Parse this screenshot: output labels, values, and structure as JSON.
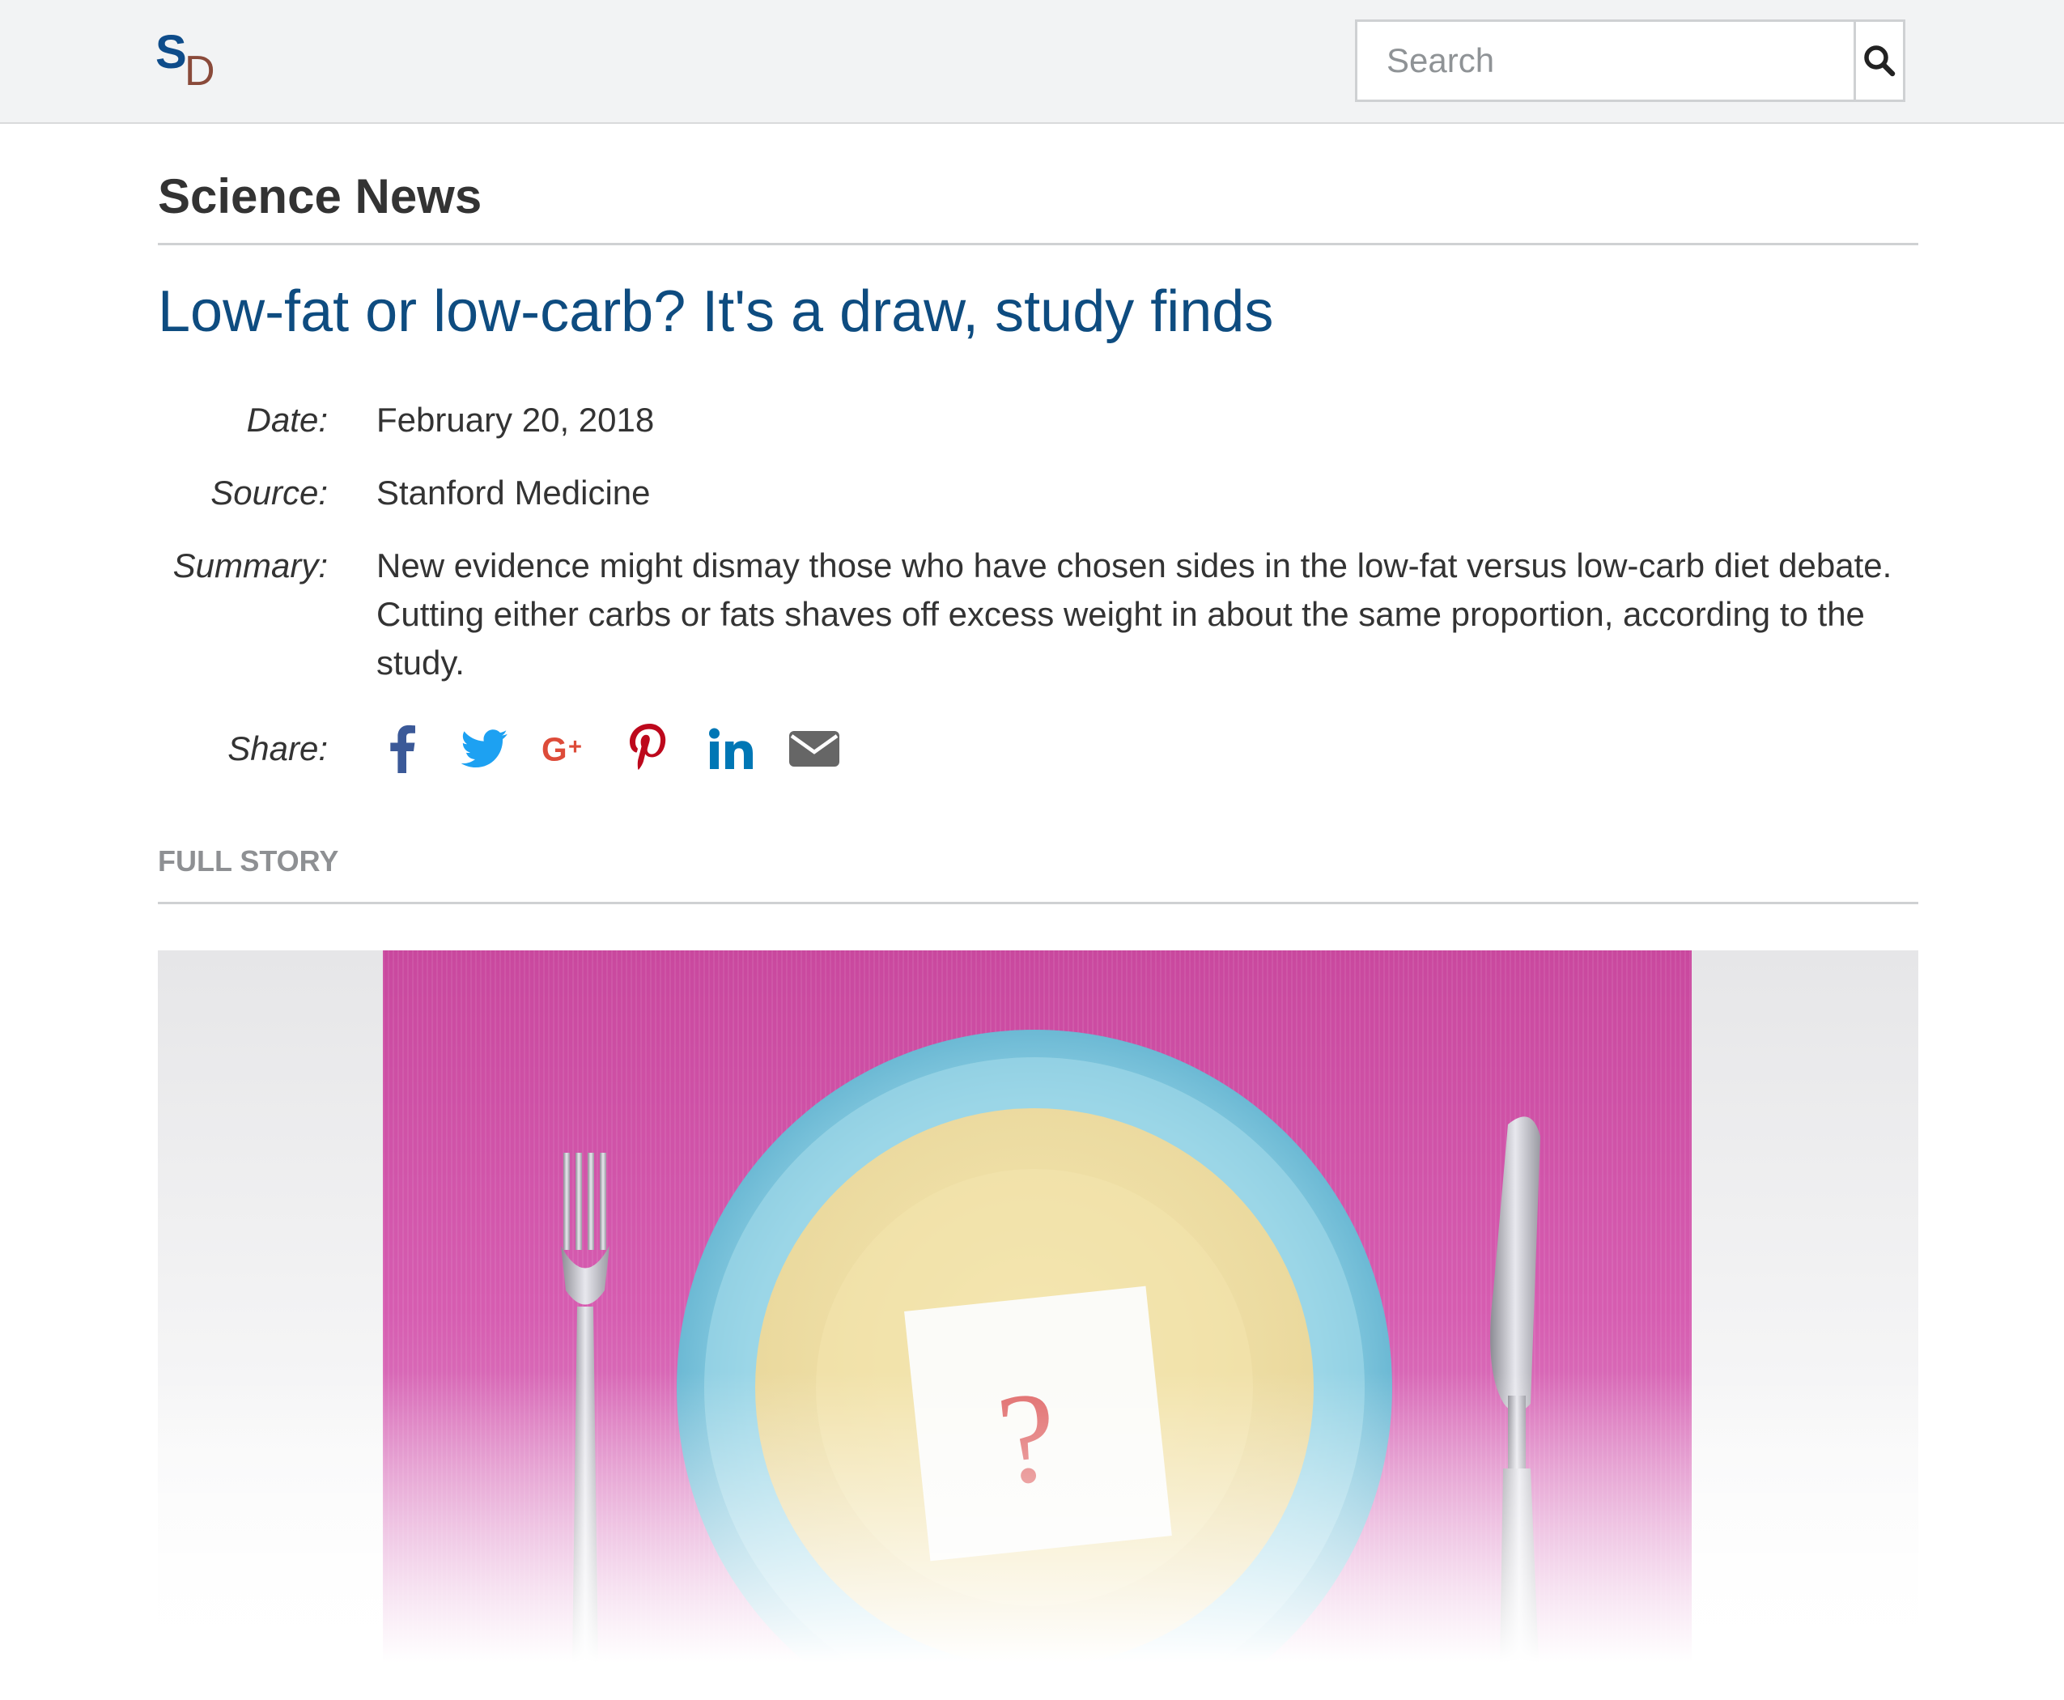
{
  "site": {
    "logo_s": "S",
    "logo_d": "D"
  },
  "search": {
    "placeholder": "Search",
    "icon": "search-icon"
  },
  "section": {
    "title": "Science News"
  },
  "article": {
    "headline": "Low-fat or low-carb? It's a draw, study finds",
    "meta": {
      "date_label": "Date:",
      "date_value": "February 20, 2018",
      "source_label": "Source:",
      "source_value": "Stanford Medicine",
      "summary_label": "Summary:",
      "summary_value": "New evidence might dismay those who have chosen sides in the low-fat versus low-carb diet debate. Cutting either carbs or fats shaves off excess weight in about the same proportion, according to the study.",
      "share_label": "Share:"
    },
    "share_icons": [
      {
        "name": "facebook-icon",
        "color": "#3b5998"
      },
      {
        "name": "twitter-icon",
        "color": "#1da1f2"
      },
      {
        "name": "google-plus-icon",
        "color": "#dd4b39"
      },
      {
        "name": "pinterest-icon",
        "color": "#bd081c"
      },
      {
        "name": "linkedin-icon",
        "color": "#0077b5"
      },
      {
        "name": "email-icon",
        "color": "#666666"
      }
    ],
    "full_story_label": "FULL STORY",
    "image": {
      "subject": "plate-with-question-mark-note",
      "note_text": "?"
    }
  },
  "colors": {
    "brand_blue": "#0e4c8a",
    "headline_blue": "#0e4c80",
    "header_bg": "#f2f3f4",
    "placemat_pink": "#d651a8",
    "plate_blue": "#7fc6dd",
    "plate_yellow": "#f1e2a8"
  }
}
